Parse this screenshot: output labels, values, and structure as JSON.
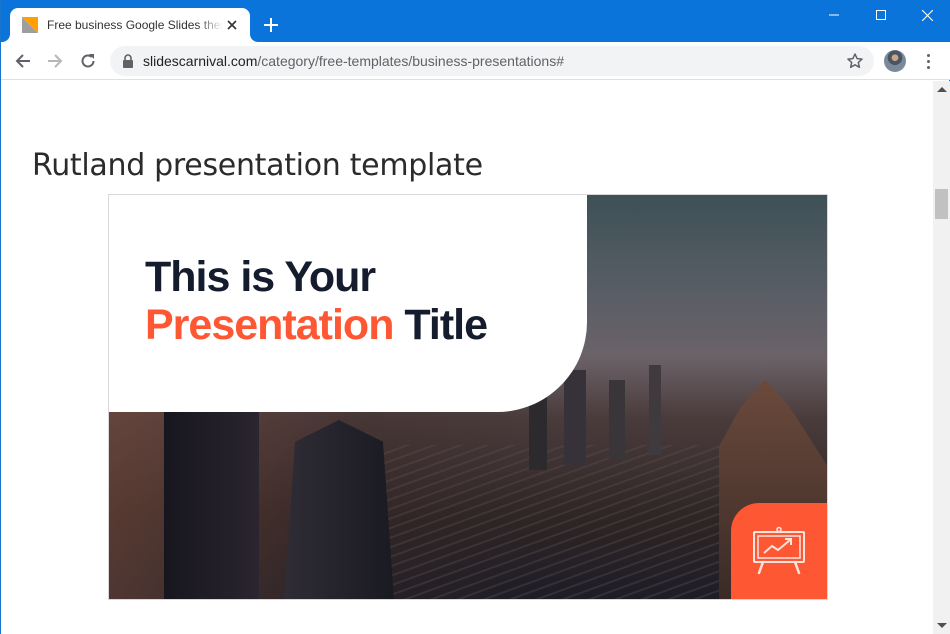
{
  "browser": {
    "tab": {
      "title": "Free business Google Slides themes and PowerPoint templates",
      "favicon": "slidescarnival-favicon"
    },
    "new_tab_label": "+",
    "window_controls": [
      "minimize",
      "maximize",
      "close"
    ],
    "address_bar": {
      "domain": "slidescarnival.com",
      "path": "/category/free-templates/business-presentations#",
      "secure": true
    },
    "colors": {
      "titlebar": "#0a74da",
      "omnibox": "#f1f3f4"
    }
  },
  "page": {
    "heading": "Rutland presentation template",
    "preview": {
      "title_line1": "This is Your",
      "title_accent": "Presentation",
      "title_line2_rest": " Title",
      "badge_icon": "presentation-chart-icon",
      "colors": {
        "accent": "#fe5733",
        "dark": "#141c2e"
      }
    }
  },
  "scrollbar": {
    "position_fraction": 0.2
  }
}
